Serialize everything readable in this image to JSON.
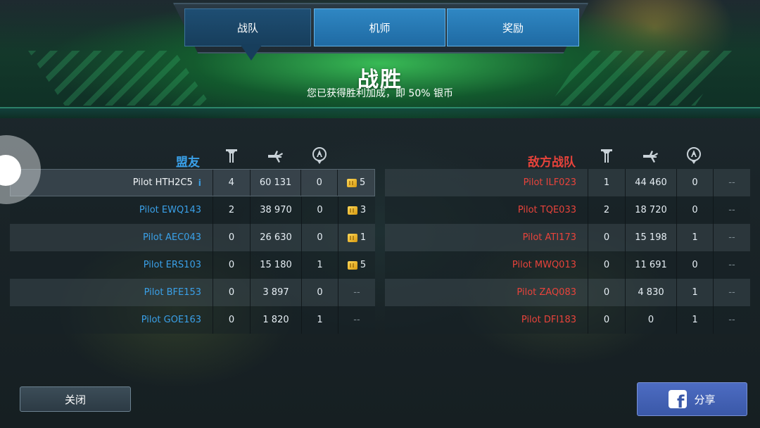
{
  "tabs": [
    {
      "label": "战队",
      "active": true
    },
    {
      "label": "机师",
      "active": false
    },
    {
      "label": "奖励",
      "active": false
    }
  ],
  "result": {
    "title": "战胜",
    "subtitle": "您已获得胜利加成，即 50% 银币"
  },
  "allies": {
    "title": "盟友",
    "column_icons": [
      "tower-icon",
      "kill-icon",
      "beacon-icon"
    ],
    "rows": [
      {
        "name": "Pilot HTH2C5",
        "c1": "4",
        "c2": "60 131",
        "c3": "0",
        "reward": "5",
        "is_me": true
      },
      {
        "name": "Pilot EWQ143",
        "c1": "2",
        "c2": "38 970",
        "c3": "0",
        "reward": "3"
      },
      {
        "name": "Pilot AEC043",
        "c1": "0",
        "c2": "26 630",
        "c3": "0",
        "reward": "1"
      },
      {
        "name": "Pilot ERS103",
        "c1": "0",
        "c2": "15 180",
        "c3": "1",
        "reward": "5"
      },
      {
        "name": "Pilot BFE153",
        "c1": "0",
        "c2": "3 897",
        "c3": "0",
        "reward": "--"
      },
      {
        "name": "Pilot GOE163",
        "c1": "0",
        "c2": "1 820",
        "c3": "1",
        "reward": "--"
      }
    ]
  },
  "enemies": {
    "title": "敌方战队",
    "column_icons": [
      "tower-icon",
      "kill-icon",
      "beacon-icon"
    ],
    "rows": [
      {
        "name": "Pilot ILF023",
        "c1": "1",
        "c2": "44 460",
        "c3": "0",
        "reward": "--"
      },
      {
        "name": "Pilot TQE033",
        "c1": "2",
        "c2": "18 720",
        "c3": "0",
        "reward": "--"
      },
      {
        "name": "Pilot ATI173",
        "c1": "0",
        "c2": "15 198",
        "c3": "1",
        "reward": "--"
      },
      {
        "name": "Pilot MWQ013",
        "c1": "0",
        "c2": "11 691",
        "c3": "0",
        "reward": "--"
      },
      {
        "name": "Pilot ZAQ083",
        "c1": "0",
        "c2": "4 830",
        "c3": "1",
        "reward": "--"
      },
      {
        "name": "Pilot DFI183",
        "c1": "0",
        "c2": "0",
        "c3": "1",
        "reward": "--"
      }
    ]
  },
  "buttons": {
    "close_label": "关闭",
    "share_label": "分享"
  },
  "colors": {
    "ally": "#3aa0e8",
    "enemy": "#e8433b",
    "accent_green": "#2fb85a",
    "tab_blue": "#2f87c3",
    "share_blue": "#4462b6"
  }
}
